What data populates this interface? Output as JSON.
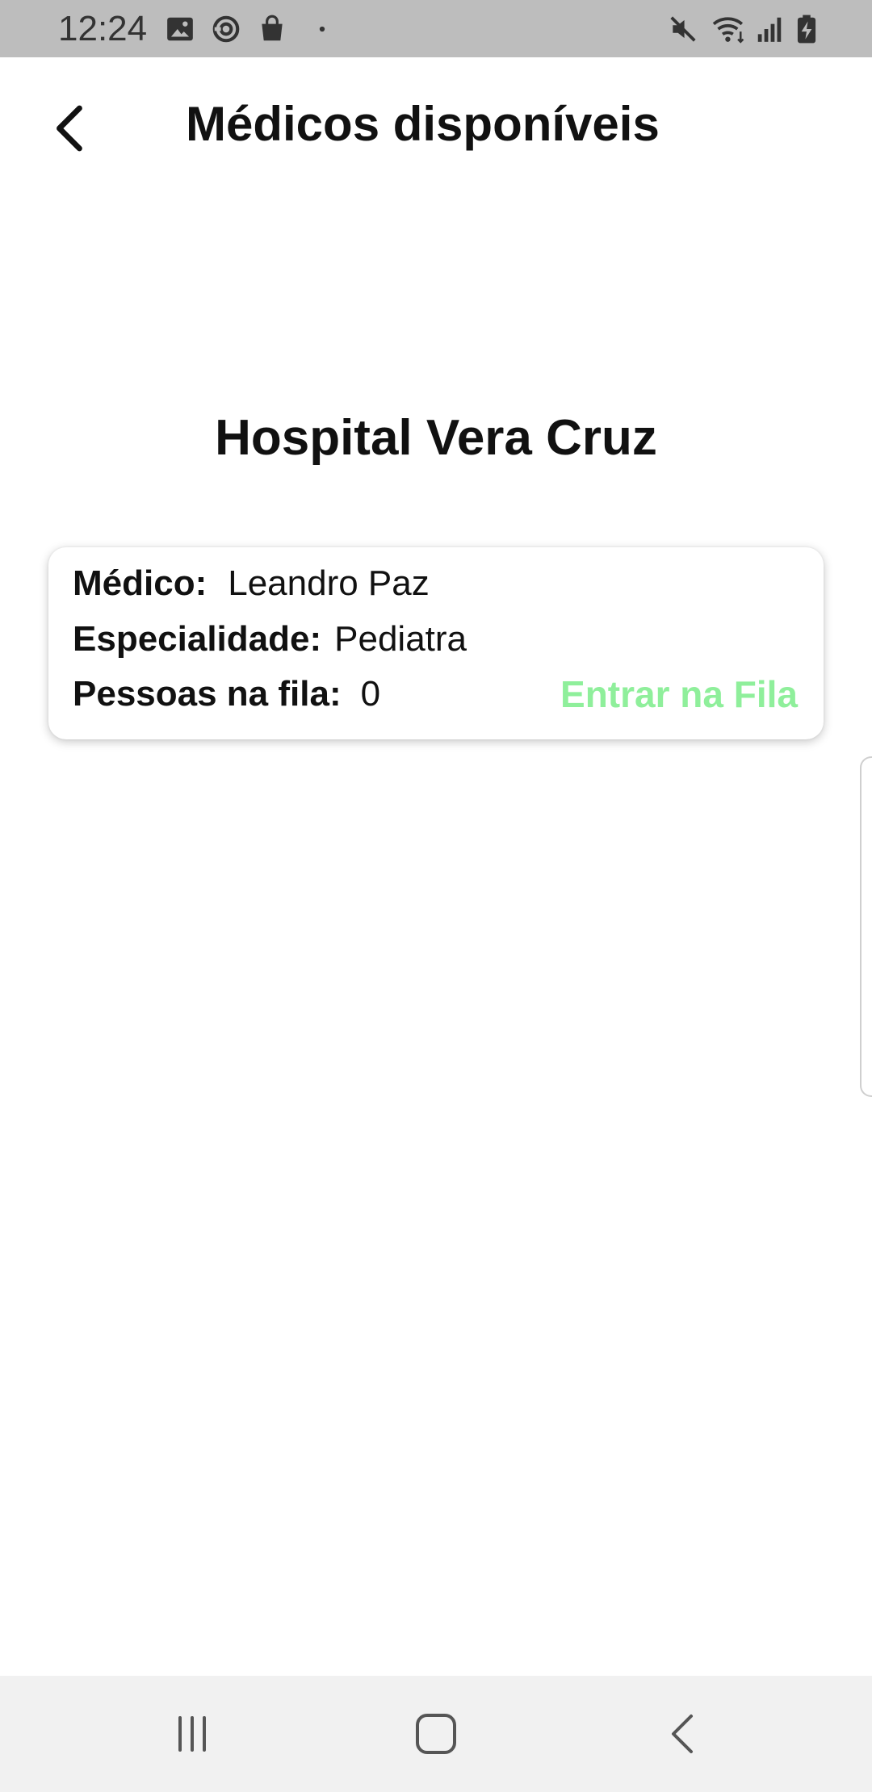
{
  "status_bar": {
    "time": "12:24",
    "left_icons": [
      "image-icon",
      "sync-icon",
      "shopping-bag-icon",
      "dot-icon"
    ],
    "right_icons": [
      "mute-icon",
      "wifi-icon",
      "signal-icon",
      "battery-charging-icon"
    ]
  },
  "header": {
    "title": "Médicos disponíveis",
    "back_icon": "chevron-left-icon"
  },
  "hospital": {
    "name": "Hospital Vera Cruz"
  },
  "doctor_card": {
    "doctor_label": "Médico:",
    "doctor_name": "Leandro Paz",
    "specialty_label": "Especialidade:",
    "specialty": "Pediatra",
    "queue_label": "Pessoas na fila:",
    "queue_count": "0",
    "join_label": "Entrar na Fila",
    "join_color": "#8fef9b"
  },
  "nav_bar": {
    "buttons": [
      "recent-apps-icon",
      "home-icon",
      "back-icon"
    ]
  }
}
